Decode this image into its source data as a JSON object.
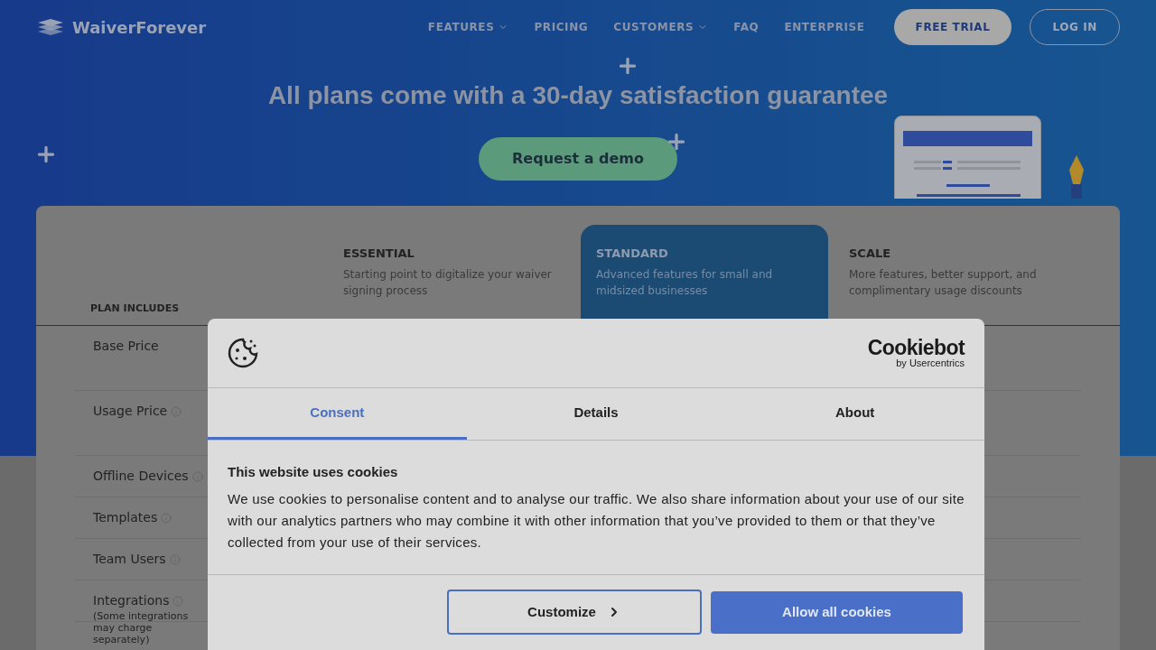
{
  "nav": {
    "logo": "WaiverForever",
    "items": [
      {
        "label": "FEATURES",
        "dropdown": true
      },
      {
        "label": "PRICING",
        "dropdown": false
      },
      {
        "label": "CUSTOMERS",
        "dropdown": true
      },
      {
        "label": "FAQ",
        "dropdown": false
      },
      {
        "label": "ENTERPRISE",
        "dropdown": false
      }
    ],
    "trial_button": "FREE TRIAL",
    "login_button": "LOG IN"
  },
  "hero": {
    "title": "All plans come with a 30-day satisfaction guarantee",
    "demo_button": "Request a demo"
  },
  "pricing": {
    "header_label": "PLAN INCLUDES",
    "plans": [
      {
        "name": "ESSENTIAL",
        "description": "Starting point to digitalize your waiver signing process",
        "highlighted": false
      },
      {
        "name": "STANDARD",
        "description": "Advanced features for small and midsized businesses",
        "highlighted": true
      },
      {
        "name": "SCALE",
        "description": "More features, better support, and complimentary usage discounts",
        "highlighted": false
      }
    ],
    "rows": [
      {
        "label": "Base Price",
        "info": false
      },
      {
        "label": "Usage Price",
        "info": true
      },
      {
        "label": "Offline Devices",
        "info": true
      },
      {
        "label": "Templates",
        "info": true
      },
      {
        "label": "Team Users",
        "info": true
      },
      {
        "label": "Integrations",
        "info": true,
        "note": "(Some integrations may charge separately)"
      }
    ]
  },
  "cookie_dialog": {
    "brand": "Cookiebot",
    "brand_sub": "by Usercentrics",
    "tabs": [
      {
        "label": "Consent",
        "selected": true
      },
      {
        "label": "Details",
        "selected": false
      },
      {
        "label": "About",
        "selected": false
      }
    ],
    "heading": "This website uses cookies",
    "body": "We use cookies to personalise content and to analyse our traffic. We also share information about your use of our site with our analytics partners who may combine it with other information that you’ve provided to them or that they’ve collected from your use of their services.",
    "customize_button": "Customize",
    "allow_button": "Allow all cookies"
  }
}
